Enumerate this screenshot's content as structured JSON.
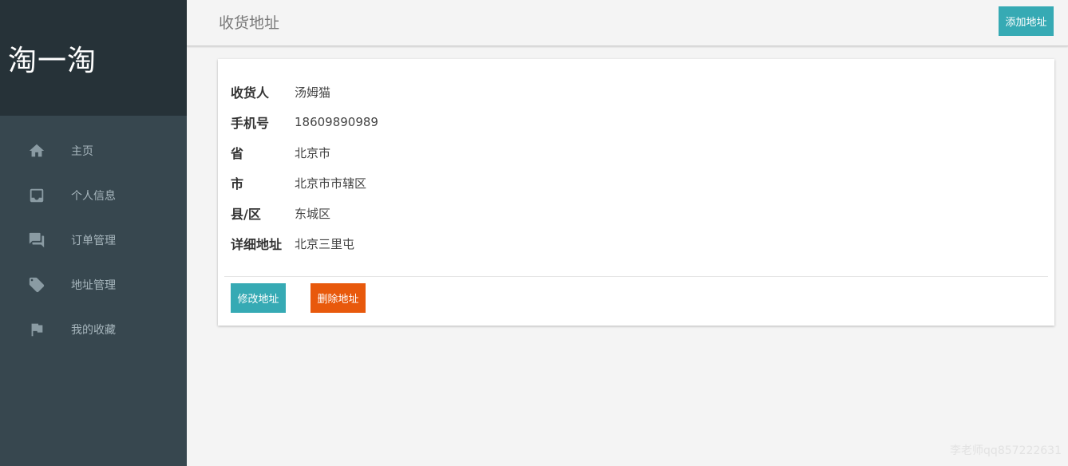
{
  "sidebar": {
    "brand": "淘一淘",
    "items": [
      {
        "label": "主页",
        "icon": "home-icon"
      },
      {
        "label": "个人信息",
        "icon": "inbox-icon"
      },
      {
        "label": "订单管理",
        "icon": "forum-icon"
      },
      {
        "label": "地址管理",
        "icon": "tag-icon"
      },
      {
        "label": "我的收藏",
        "icon": "flag-icon"
      }
    ]
  },
  "header": {
    "title": "收货地址",
    "add_label": "添加地址"
  },
  "address": {
    "fields": [
      {
        "key": "收货人",
        "value": "汤姆猫"
      },
      {
        "key": "手机号",
        "value": "18609890989"
      },
      {
        "key": "省",
        "value": "北京市"
      },
      {
        "key": "市",
        "value": "北京市市辖区"
      },
      {
        "key": "县/区",
        "value": "东城区"
      },
      {
        "key": "详细地址",
        "value": "北京三里屯"
      }
    ],
    "edit_label": "修改地址",
    "delete_label": "删除地址"
  },
  "watermark": "李老师qq857222631",
  "colors": {
    "sidebar_bg": "#37474f",
    "brand_bg": "#263238",
    "accent": "#36aab4",
    "danger": "#e8590c"
  }
}
